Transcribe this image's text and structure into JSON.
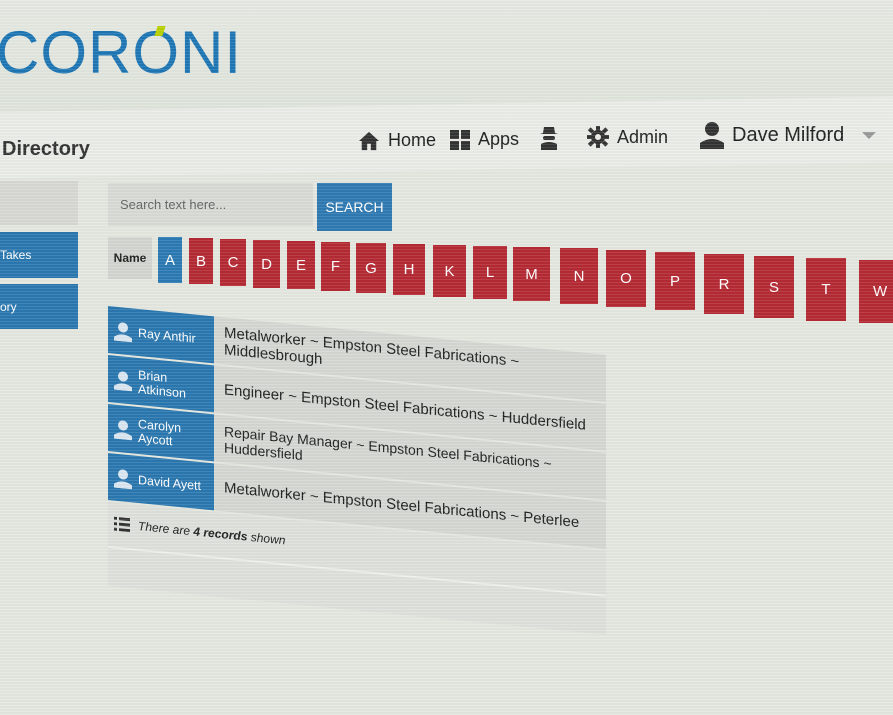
{
  "app": {
    "logo_text": "CORONI",
    "page_title": "Directory"
  },
  "nav": {
    "home_label": "Home",
    "apps_label": "Apps",
    "admin_label": "Admin",
    "user_name": "Dave Milford"
  },
  "sidebar": {
    "items": [
      {
        "label": ""
      },
      {
        "label": "Takes"
      },
      {
        "label": "ory"
      }
    ]
  },
  "search": {
    "placeholder": "Search text here...",
    "button_label": "SEARCH"
  },
  "filter": {
    "label": "Name",
    "letters": [
      "A",
      "B",
      "C",
      "D",
      "E",
      "F",
      "G",
      "H",
      "K",
      "L",
      "M",
      "N",
      "O",
      "P",
      "R",
      "S",
      "T",
      "W"
    ],
    "active_letter": "A"
  },
  "records": {
    "rows": [
      {
        "name": "Ray Anthir",
        "detail": "Metalworker ~ Empston Steel Fabrications ~ Middlesbrough"
      },
      {
        "name": "Brian Atkinson",
        "detail": "Engineer ~ Empston Steel Fabrications ~ Huddersfield"
      },
      {
        "name": "Carolyn Aycott",
        "detail": "Repair Bay Manager ~ Empston Steel Fabrications ~ Huddersfield"
      },
      {
        "name": "David Ayett",
        "detail": "Metalworker ~ Empston Steel Fabrications ~ Peterlee"
      }
    ],
    "summary_prefix": "There are ",
    "summary_count": "4 records",
    "summary_suffix": " shown"
  },
  "colors": {
    "accent_blue": "#2b78b0",
    "letter_red": "#b52a33",
    "logo_green": "#b9d200"
  }
}
